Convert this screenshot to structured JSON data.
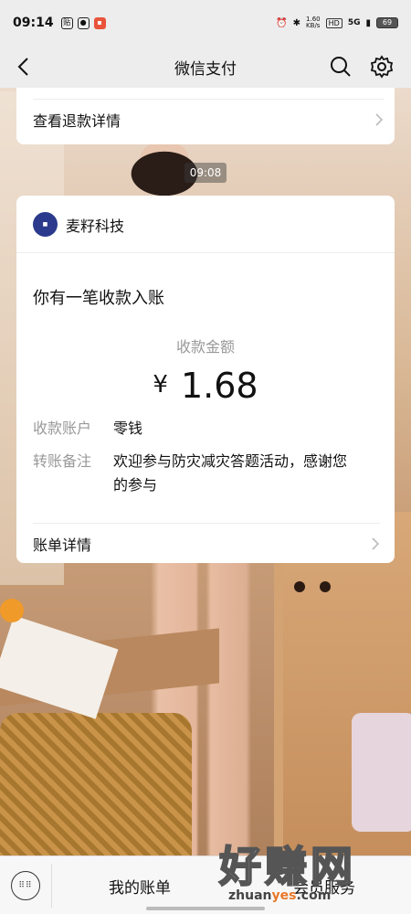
{
  "status_bar": {
    "time": "09:14",
    "left_icons": [
      "贴",
      "chat",
      "cat"
    ],
    "net_speed": "1.60\nKB/s",
    "hd": "HD",
    "signal": "5G",
    "battery": "69"
  },
  "nav": {
    "title": "微信支付"
  },
  "refund_card": {
    "label": "查看退款详情"
  },
  "time_chip": "09:08",
  "payment_card": {
    "merchant": "麦籽科技",
    "notice": "你有一笔收款入账",
    "amount_label": "收款金额",
    "currency": "¥",
    "amount": "1.68",
    "account_key": "收款账户",
    "account_value": "零钱",
    "remark_key": "转账备注",
    "remark_value_line1": "欢迎参与防灾减灾答题活动，感谢您",
    "remark_value_line2": "的参与",
    "footer": "账单详情"
  },
  "bottom_bar": {
    "menu_left": "我的账单",
    "menu_right": "会员服务"
  },
  "watermark": {
    "big": "好赚网",
    "small_a": "zhuan",
    "small_b": "yes",
    "small_c": ".com"
  },
  "colors": {
    "nav_bg": "#ededed",
    "card_bg": "#ffffff",
    "muted_text": "#999999"
  }
}
